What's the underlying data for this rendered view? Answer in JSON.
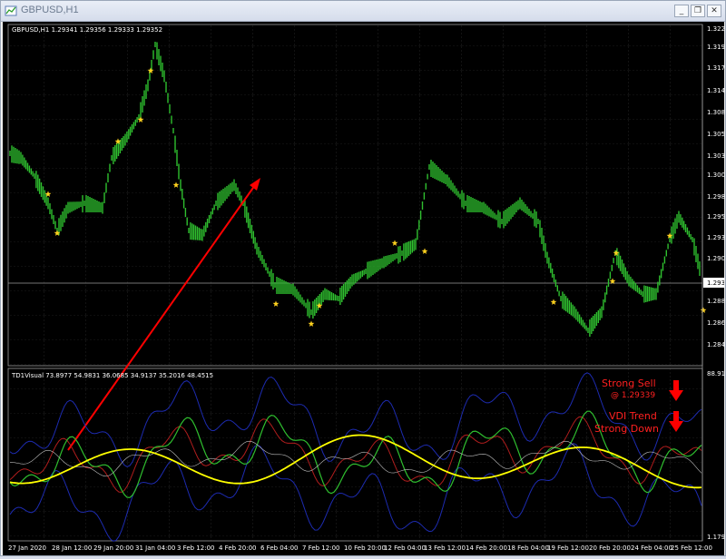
{
  "window": {
    "title": "GBPUSD,H1",
    "buttons": {
      "minimize": "_",
      "restore": "❐",
      "close": "✕"
    }
  },
  "main_header": "GBPUSD,H1  1.29341 1.29356 1.29333 1.29352",
  "price_axis": {
    "labels": [
      "1.3225",
      "1.3195",
      "1.3170",
      "1.3145",
      "1.3080",
      "1.3055",
      "1.3030",
      "1.3005",
      "1.2980",
      "1.2955",
      "1.2930",
      "1.2905",
      "1.2880",
      "1.2860",
      "1.2845"
    ],
    "current_price": "1.2935"
  },
  "indicator": {
    "header": "TD1Visual 73.8977 54.9831 36.0685 34.9137 35.2016 48.4515",
    "axis_top": "88.915",
    "axis_bottom": "1.1795",
    "annotations": {
      "line1": "Strong Sell",
      "line2": "@ 1.29339",
      "line3": "VDI Trend",
      "line4": "Strong Down"
    }
  },
  "time_axis": [
    "27 Jan 2020",
    "28 Jan 12:00",
    "29 Jan 20:00",
    "31 Jan 04:00",
    "3 Feb 12:00",
    "4 Feb 20:00",
    "6 Feb 04:00",
    "7 Feb 12:00",
    "10 Feb 20:00",
    "12 Feb 04:00",
    "13 Feb 12:00",
    "14 Feb 20:00",
    "18 Feb 04:00",
    "19 Feb 12:00",
    "20 Feb 20:00",
    "24 Feb 04:00",
    "25 Feb 12:00"
  ],
  "colors": {
    "background": "#000000",
    "candles": "#2fbf2f",
    "signal_star": "#ffd21f",
    "arrow": "#ff0000",
    "yellow_line": "#ffff00",
    "band": "#1d2bb0"
  }
}
